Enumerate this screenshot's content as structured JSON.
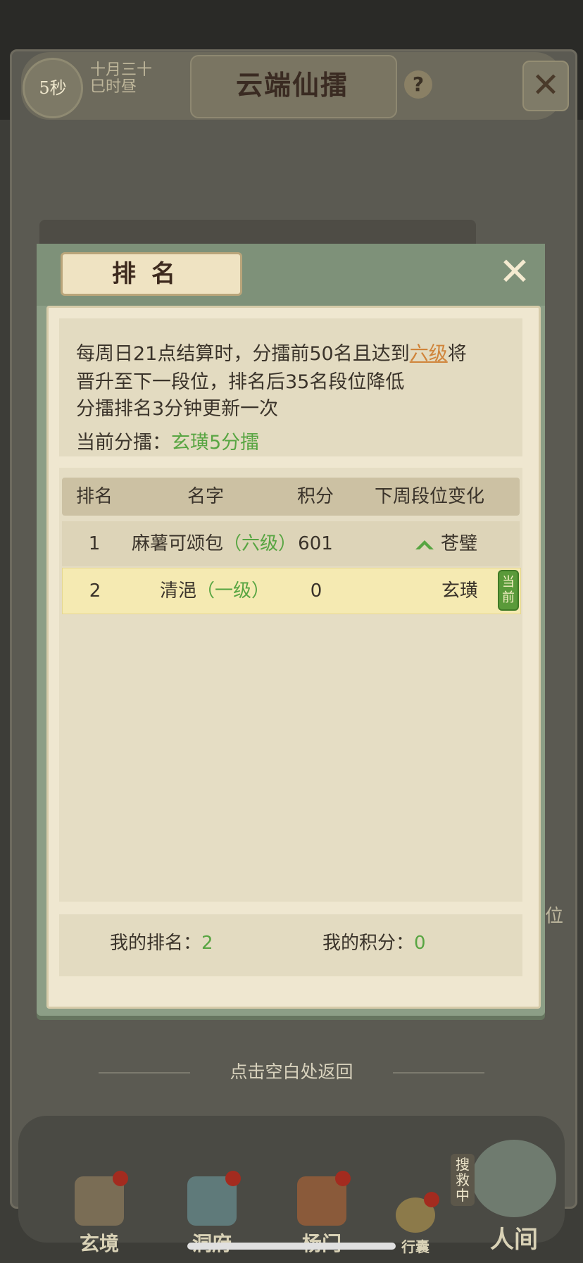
{
  "background": {
    "timer": "5秒",
    "date_line1": "十月三十",
    "date_line2": "巳时昼",
    "title": "云端仙擂",
    "help": "?",
    "side_text": "位",
    "nav": [
      {
        "label": "玄境"
      },
      {
        "label": "洞府"
      },
      {
        "label": "杨门"
      },
      {
        "label": "行囊"
      },
      {
        "label": "人间"
      }
    ],
    "rescue_tag": "搜救中"
  },
  "modal": {
    "title": "排名",
    "info": {
      "line1_a": "每周日21点结算时，分擂前50名且达到",
      "line1_link": "六级",
      "line1_b": "将",
      "line2": "晋升至下一段位，排名后35名段位降低",
      "line3": "分擂排名3分钟更新一次",
      "current_label": "当前分擂：",
      "current_value": "玄璜5分擂"
    },
    "table": {
      "headers": [
        "排名",
        "名字",
        "积分",
        "下周段位变化"
      ],
      "rows": [
        {
          "rank": "1",
          "name": "麻薯可颂包",
          "level": "（六级）",
          "score": "601",
          "change": "苍璧",
          "trend": "up"
        },
        {
          "rank": "2",
          "name": "清浥",
          "level": "（一级）",
          "score": "0",
          "change": "玄璜",
          "tag": "当前"
        }
      ]
    },
    "my_rank_label": "我的排名：",
    "my_rank_value": "2",
    "my_score_label": "我的积分：",
    "my_score_value": "0",
    "hint": "点击空白处返回"
  },
  "colors": {
    "accent_green": "#58a542",
    "link_orange": "#d0843a",
    "panel_green": "#8c9e86"
  }
}
